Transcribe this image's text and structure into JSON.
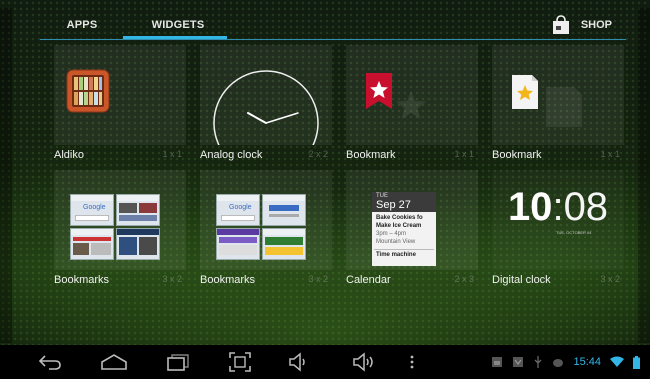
{
  "tabs": {
    "apps": "APPS",
    "widgets": "WIDGETS",
    "shop": "SHOP"
  },
  "widgets": [
    {
      "name": "Aldiko",
      "size": "1 x 1"
    },
    {
      "name": "Analog clock",
      "size": "2 x 2"
    },
    {
      "name": "Bookmark",
      "size": "1 x 1"
    },
    {
      "name": "Bookmark",
      "size": "1 x 1"
    },
    {
      "name": "Bookmarks",
      "size": "3 x 2"
    },
    {
      "name": "Bookmarks",
      "size": "3 x 2"
    },
    {
      "name": "Calendar",
      "size": "2 x 3"
    },
    {
      "name": "Digital clock",
      "size": "3 x 2"
    }
  ],
  "calendar_preview": {
    "dow": "TUE",
    "date": "Sep 27",
    "event1_line1": "Bake Cookies fo",
    "event1_line2": "Make Ice Cream",
    "event1_time": "3pm – 4pm",
    "event1_place": "Mountain View",
    "event2": "Time machine"
  },
  "digital_clock_preview": {
    "hour": "10",
    "minute": "08",
    "sub": "TUE, OCTOBER 04"
  },
  "bookmarks_preview": {
    "search_brand": "Google"
  },
  "status": {
    "time": "15:44"
  },
  "colors": {
    "accent": "#33b5e5",
    "bookmark_red": "#c8102e",
    "bookmark_gold": "#f2b51b"
  }
}
